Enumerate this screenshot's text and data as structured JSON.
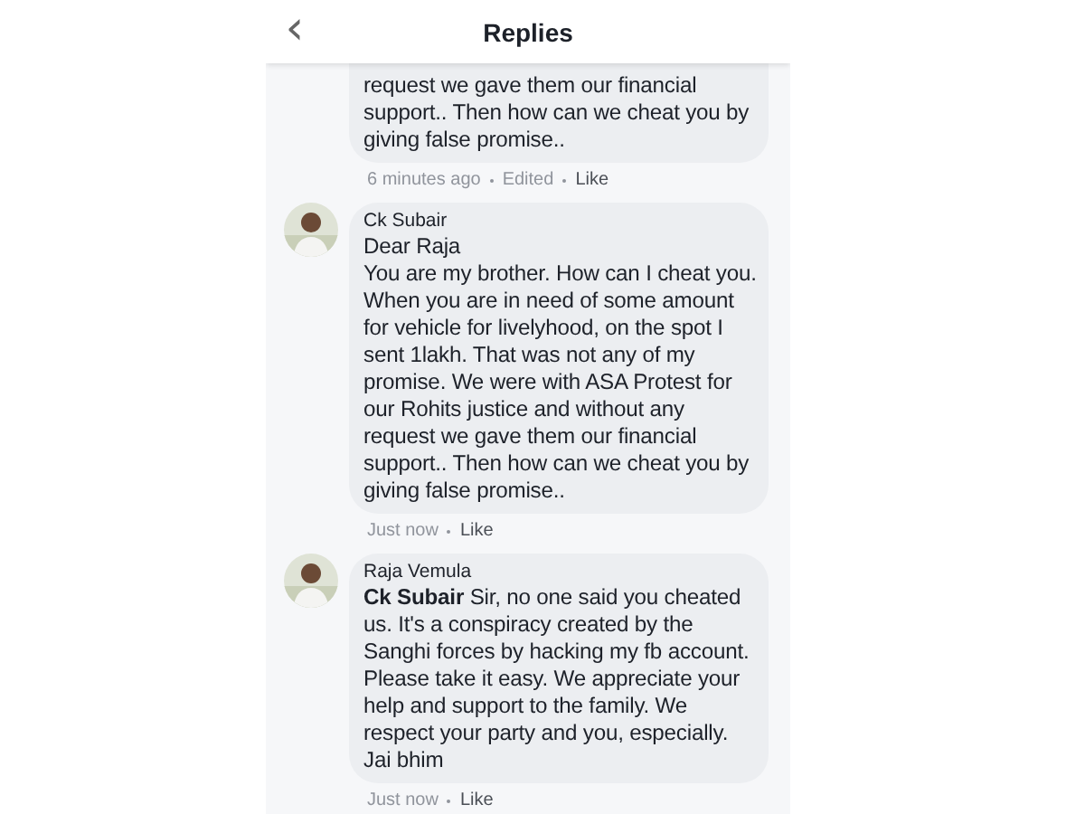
{
  "header": {
    "back": "‹",
    "title": "Replies"
  },
  "comments": [
    {
      "cut_top": true,
      "text": "request we gave them our financial support.. Then how can we cheat you by giving false promise..",
      "time": "6 minutes ago",
      "edited": "Edited",
      "like": "Like"
    },
    {
      "cut_top": false,
      "author": "Ck Subair",
      "text": "Dear Raja\nYou are my brother. How can I cheat you. When you are in need of some amount for vehicle for livelyhood,  on the spot I sent 1lakh. That was not any  of my promise. We were with ASA Protest for our Rohits justice  and without any request we gave them our financial support.. Then how can we cheat you by giving false promise..",
      "time": "Just now",
      "like": "Like"
    },
    {
      "cut_top": false,
      "author": "Raja Vemula",
      "text": "**Ck Subair** Sir, no one said you cheated us. It's a conspiracy created by the Sanghi forces by hacking my fb account. Please take it easy. We appreciate your help and support to the family. We respect your party and you, especially. Jai bhim",
      "time": "Just now",
      "like": "Like"
    }
  ]
}
